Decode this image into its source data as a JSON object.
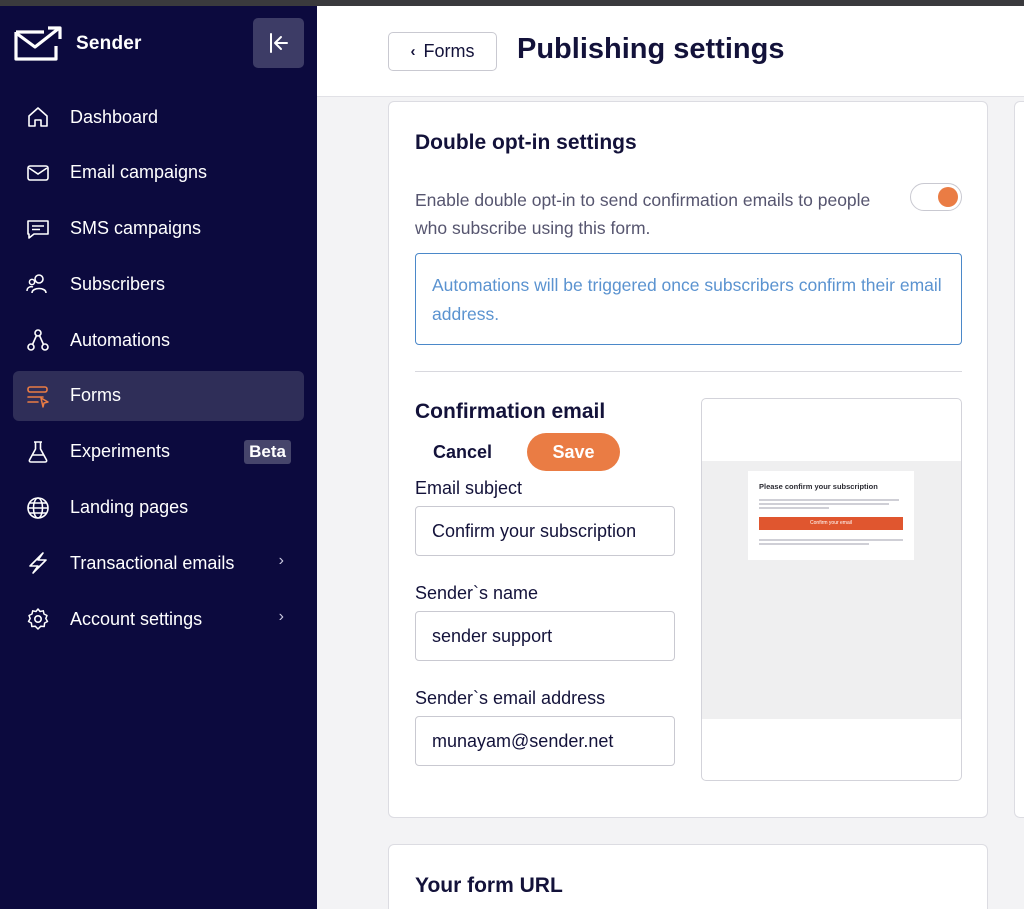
{
  "app": {
    "brand": "Sender"
  },
  "sidebar": {
    "items": [
      {
        "label": "Dashboard",
        "icon": "home-icon"
      },
      {
        "label": "Email campaigns",
        "icon": "mail-icon"
      },
      {
        "label": "SMS campaigns",
        "icon": "chat-icon"
      },
      {
        "label": "Subscribers",
        "icon": "users-icon"
      },
      {
        "label": "Automations",
        "icon": "automation-icon"
      },
      {
        "label": "Forms",
        "icon": "forms-icon",
        "active": true
      },
      {
        "label": "Experiments",
        "icon": "flask-icon",
        "badge": "Beta"
      },
      {
        "label": "Landing pages",
        "icon": "globe-icon"
      },
      {
        "label": "Transactional emails",
        "icon": "lightning-icon",
        "chevron": "›"
      },
      {
        "label": "Account settings",
        "icon": "gear-icon",
        "chevron": "›"
      }
    ]
  },
  "header": {
    "back_label": "Forms",
    "back_chevron": "‹",
    "title": "Publishing settings"
  },
  "double_opt_in": {
    "title": "Double opt-in settings",
    "description": "Enable double opt-in to send confirmation emails to people who subscribe using this form.",
    "enabled": true,
    "info": "Automations will be triggered once subscribers confirm their email address."
  },
  "confirmation_email": {
    "title": "Confirmation email",
    "cancel_label": "Cancel",
    "save_label": "Save",
    "subject_label": "Email subject",
    "subject_value": "Confirm your subscription",
    "sender_name_label": "Sender`s name",
    "sender_name_value": "sender support",
    "sender_email_label": "Sender`s email address",
    "sender_email_value": "munayam@sender.net",
    "preview": {
      "heading": "Please confirm your subscription",
      "button": "Confirm your email"
    }
  },
  "form_url": {
    "title": "Your form URL"
  },
  "colors": {
    "sidebar_bg": "#0c0a3e",
    "accent": "#ea7c44",
    "info_blue": "#5b93d0",
    "text_dark": "#13123a"
  }
}
